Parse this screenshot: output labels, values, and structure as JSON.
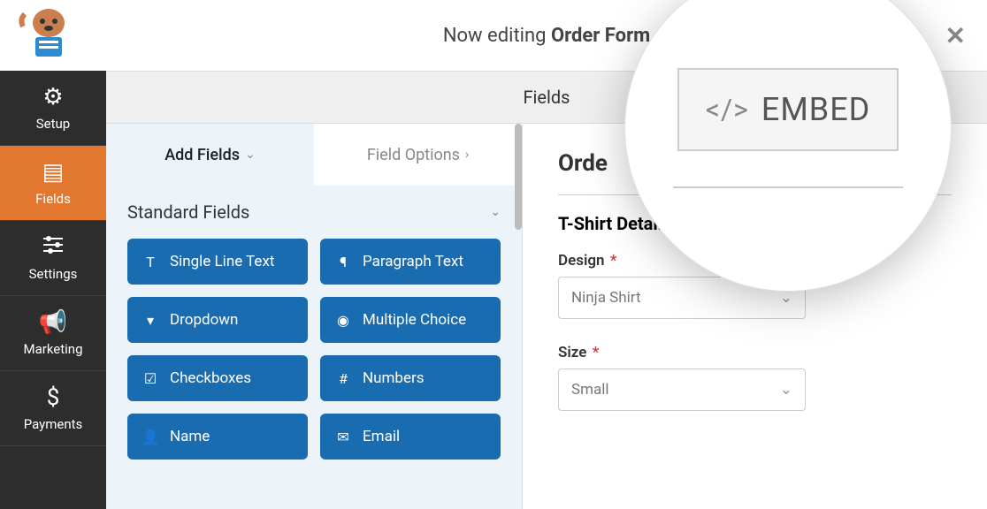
{
  "header": {
    "editing_prefix": "Now editing ",
    "editing_title": "Order Form",
    "embed_label": "EMBED"
  },
  "top_tabs": {
    "fields": "Fields"
  },
  "sidebar": {
    "items": [
      {
        "label": "Setup"
      },
      {
        "label": "Fields"
      },
      {
        "label": "Settings"
      },
      {
        "label": "Marketing"
      },
      {
        "label": "Payments"
      }
    ]
  },
  "panel": {
    "add_fields": "Add Fields",
    "field_options": "Field Options",
    "section": "Standard Fields",
    "fields": [
      "Single Line Text",
      "Paragraph Text",
      "Dropdown",
      "Multiple Choice",
      "Checkboxes",
      "Numbers",
      "Name",
      "Email"
    ]
  },
  "preview": {
    "title_partial": "Orde",
    "section": "T-Shirt Details",
    "design_label": "Design",
    "design_value": "Ninja Shirt",
    "size_label": "Size",
    "size_value": "Small",
    "asterisk": "*"
  }
}
